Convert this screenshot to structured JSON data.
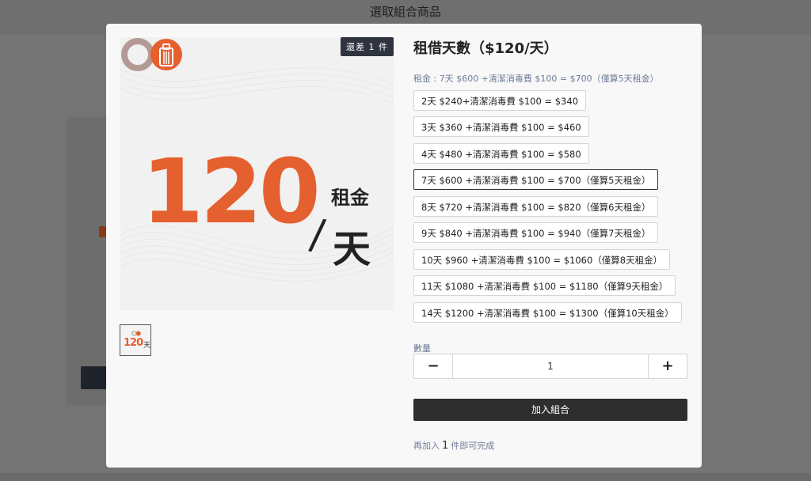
{
  "page": {
    "title": "選取組合商品"
  },
  "product": {
    "badge": "還差 1 件",
    "image": {
      "number": "120",
      "unit_top": "租金",
      "slash": "/",
      "unit_bottom": "天",
      "thumb_number": "120",
      "thumb_unit": "天"
    },
    "title": "租借天數（$120/天）",
    "selected_summary": "租金 : 7天 $600 +清潔消毒費 $100 = $700（僅算5天租金）",
    "options": [
      "2天 $240+清潔消毒費 $100 = $340",
      "3天 $360 +清潔消毒費 $100 = $460",
      "4天 $480 +清潔消毒費 $100 = $580",
      "7天 $600 +清潔消毒費 $100 = $700（僅算5天租金）",
      "8天 $720 +清潔消毒費 $100 = $820（僅算6天租金）",
      "9天 $840 +清潔消毒費 $100 = $940（僅算7天租金）",
      "10天 $960 +清潔消毒費 $100 = $1060（僅算8天租金）",
      "11天 $1080 +清潔消毒費 $100 = $1180（僅算9天租金）",
      "14天 $1200 +清潔消毒費 $100 = $1300（僅算10天租金）"
    ],
    "selected_option_index": 3,
    "quantity": {
      "label": "數量",
      "value": "1",
      "minus_icon": "minus-icon",
      "plus_icon": "plus-icon"
    },
    "add_button": "加入組合",
    "hint": {
      "prefix": "再加入",
      "count": "1",
      "suffix": "件即可完成"
    }
  },
  "colors": {
    "accent_orange": "#e5602f",
    "dark_button": "#2e2e2e",
    "badge_bg": "#2f3440",
    "muted_text": "#6d7c97"
  }
}
